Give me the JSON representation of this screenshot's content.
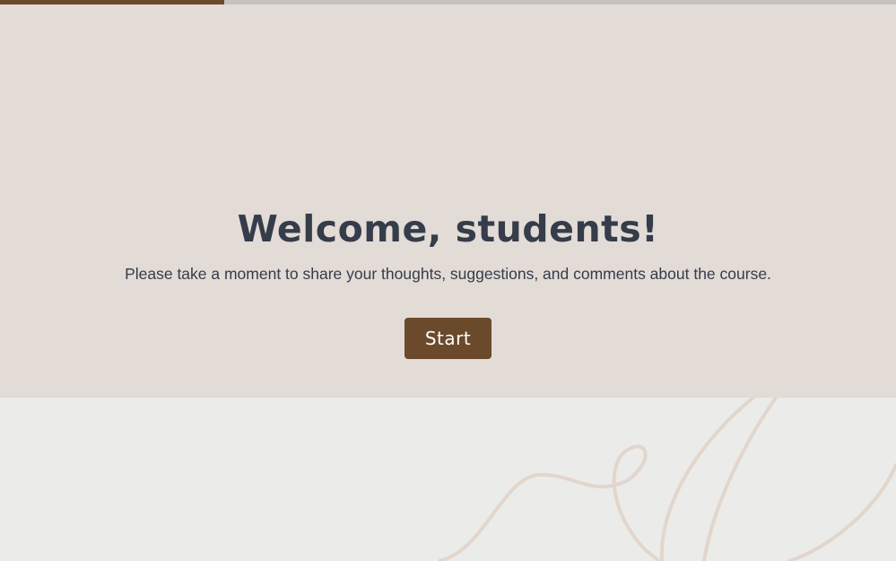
{
  "progress": {
    "fraction": 0.25
  },
  "hero": {
    "title": "Welcome, students!",
    "subtitle": "Please take a moment to share your thoughts, suggestions, and comments about the course.",
    "start_label": "Start"
  },
  "colors": {
    "accent": "#6b4a2b",
    "hero_background": "#e2dbd6",
    "page_background": "#ebebea",
    "text": "#353c4a",
    "decoration_line": "#e2d6cc"
  }
}
